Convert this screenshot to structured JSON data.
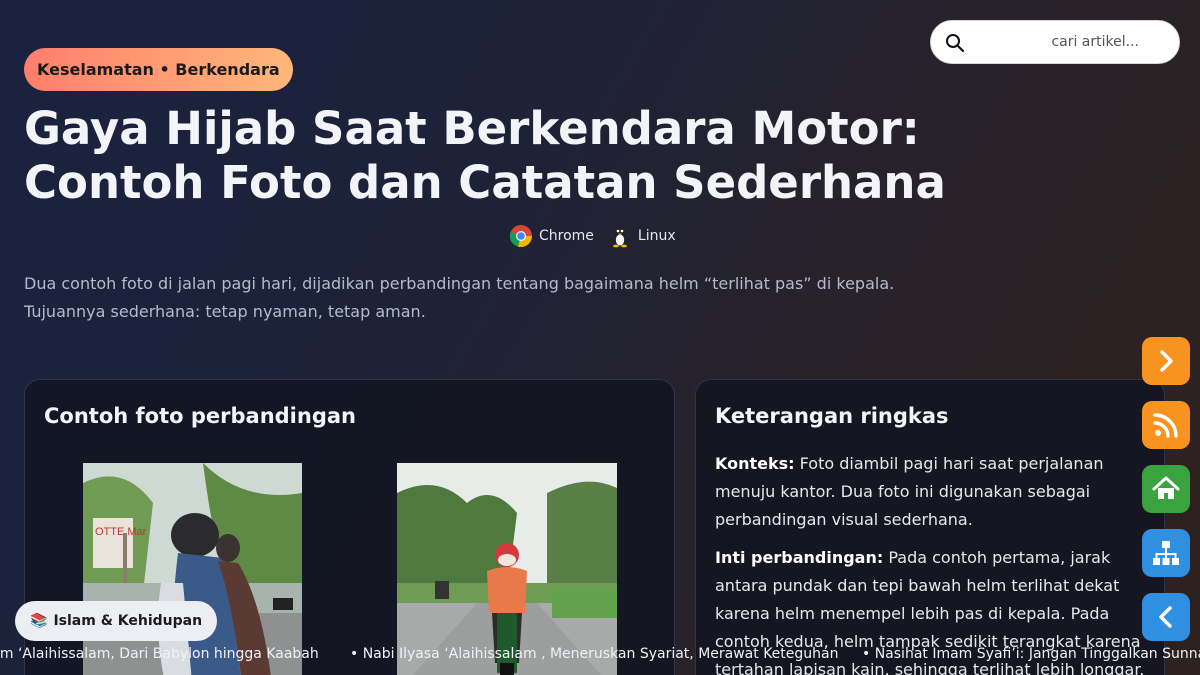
{
  "category_pill": "Keselamatan • Berkendara",
  "search": {
    "placeholder": "cari artikel..."
  },
  "title_line1": "Gaya Hijab Saat Berkendara Motor:",
  "title_line2": "Contoh Foto dan Catatan Sederhana",
  "badges": [
    {
      "label": "Chrome",
      "icon": "chrome-icon"
    },
    {
      "label": "Linux",
      "icon": "linux-tux-icon"
    }
  ],
  "lead_line1": "Dua contoh foto di jalan pagi hari, dijadikan perbandingan tentang bagaimana helm “terlihat pas” di kepala.",
  "lead_line2": "Tujuannya sederhana: tetap nyaman, tetap aman.",
  "photos_card": {
    "title": "Contoh foto perbandingan"
  },
  "info_card": {
    "title": "Keterangan ringkas",
    "konteks_label": "Konteks:",
    "konteks_text": " Foto diambil pagi hari saat perjalanan menuju kantor. Dua foto ini digunakan sebagai perbandingan visual sederhana.",
    "inti_label": "Inti perbandingan:",
    "inti_text": " Pada contoh pertama, jarak antara pundak dan tepi bawah helm terlihat dekat karena helm menempel lebih pas di kepala. Pada contoh kedua, helm tampak sedikit terangkat karena tertahan lapisan kain, sehingga terlihat lebih longgar."
  },
  "side_buttons": [
    {
      "icon": "chevron-right-icon",
      "color": "#f7931e"
    },
    {
      "icon": "rss-icon",
      "color": "#f7931e"
    },
    {
      "icon": "home-icon",
      "color": "#3aa33f"
    },
    {
      "icon": "sitemap-icon",
      "color": "#2f8fe0"
    },
    {
      "icon": "chevron-left-icon",
      "color": "#2f8fe0"
    }
  ],
  "category_chip": {
    "emoji": "📚",
    "label": "Islam & Kehidupan"
  },
  "ticker": [
    "im ‘Alaihissalam, Dari Babylon hingga Kaabah",
    "•  Nabi Ilyasa ‘Alaihissalam , Meneruskan Syariat, Merawat Keteguhan",
    "•  Nasihat Imam Syafi’i: Jangan Tinggalkan Sunnah"
  ]
}
